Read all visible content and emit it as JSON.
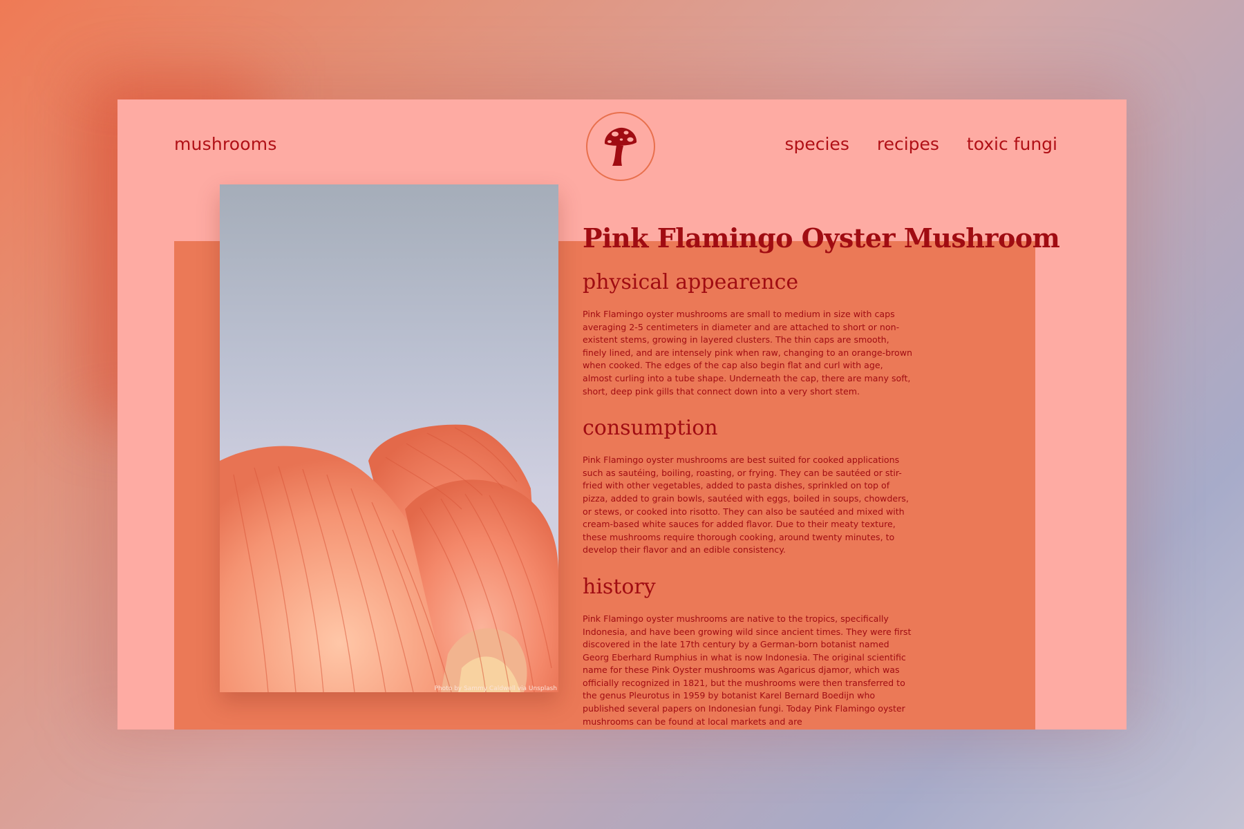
{
  "header": {
    "brand": "mushrooms",
    "nav": [
      {
        "label": "species"
      },
      {
        "label": "recipes"
      },
      {
        "label": "toxic fungi"
      }
    ]
  },
  "hero_image": {
    "credit": "Photo by Sammy Caldwell via Unsplash"
  },
  "article": {
    "title": "Pink Flamingo Oyster Mushroom",
    "sections": [
      {
        "heading": "physical appearence",
        "text": "Pink Flamingo oyster mushrooms are small to medium in size with caps averaging 2-5 centimeters in diameter and are attached to short or non-existent stems, growing in layered clusters. The thin caps are smooth, finely lined, and are intensely pink when raw, changing to an orange-brown when cooked. The edges of the cap also begin flat and curl with age, almost curling into a tube shape. Underneath the cap, there are many soft, short, deep pink gills that connect down into a very short stem."
      },
      {
        "heading": "consumption",
        "text": "Pink Flamingo oyster mushrooms are best suited for cooked applications such as sautéing, boiling, roasting, or frying. They can be sautéed or stir-fried with other vegetables, added to pasta dishes, sprinkled on top of pizza, added to grain bowls, sautéed with eggs, boiled in soups, chowders, or stews, or cooked into risotto. They can also be sautéed and mixed with cream-based white sauces for added flavor. Due to their meaty texture, these mushrooms require thorough cooking, around twenty minutes, to develop their flavor and an edible consistency."
      },
      {
        "heading": "history",
        "text": "Pink Flamingo oyster mushrooms are native to the tropics, specifically Indonesia, and have been growing wild since ancient times. They were first discovered in the late 17th century by a German-born botanist named Georg Eberhard Rumphius in what is now Indonesia. The original scientific name for these Pink Oyster mushrooms was Agaricus djamor, which was officially recognized in 1821, but the mushrooms were then transferred to the genus Pleurotus in 1959 by botanist Karel Bernard Boedijn who published several papers on Indonesian fungi. Today Pink Flamingo oyster mushrooms can be found at local markets and are"
      }
    ]
  },
  "colors": {
    "page_bg": "#feaba3",
    "band": "#eb7957",
    "text": "#a00c12",
    "accent": "#e8704d"
  },
  "icons": [
    "mushroom-logo-icon"
  ]
}
